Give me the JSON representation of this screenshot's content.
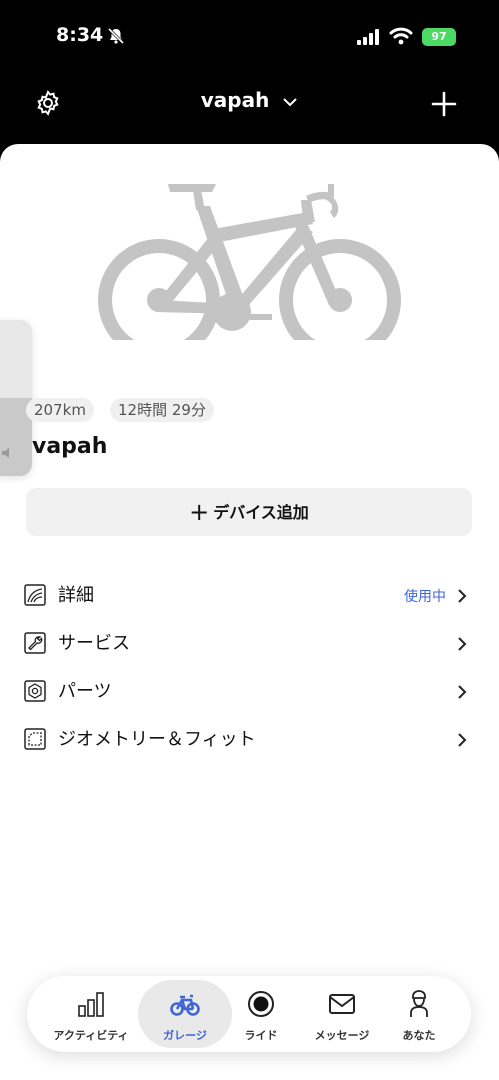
{
  "status_bar": {
    "time": "8:34",
    "battery": "97"
  },
  "header": {
    "title": "vapah"
  },
  "bike": {
    "distance": "207km",
    "duration": "12時間 29分",
    "name": "vapah"
  },
  "add_device_label": "デバイス追加",
  "menu": [
    {
      "label": "詳細",
      "badge": "使用中"
    },
    {
      "label": "サービス",
      "badge": ""
    },
    {
      "label": "パーツ",
      "badge": ""
    },
    {
      "label": "ジオメトリー＆フィット",
      "badge": ""
    }
  ],
  "tabs": [
    {
      "label": "アクティビティ",
      "icon": "activity-bars-icon"
    },
    {
      "label": "ガレージ",
      "icon": "bike-icon",
      "active": true
    },
    {
      "label": "ライド",
      "icon": "record-icon"
    },
    {
      "label": "メッセージ",
      "icon": "mail-icon"
    },
    {
      "label": "あなた",
      "icon": "person-icon"
    }
  ],
  "colors": {
    "accent": "#3f66d6",
    "battery": "#4cd964",
    "bike_silhouette": "#c4c4c4"
  }
}
